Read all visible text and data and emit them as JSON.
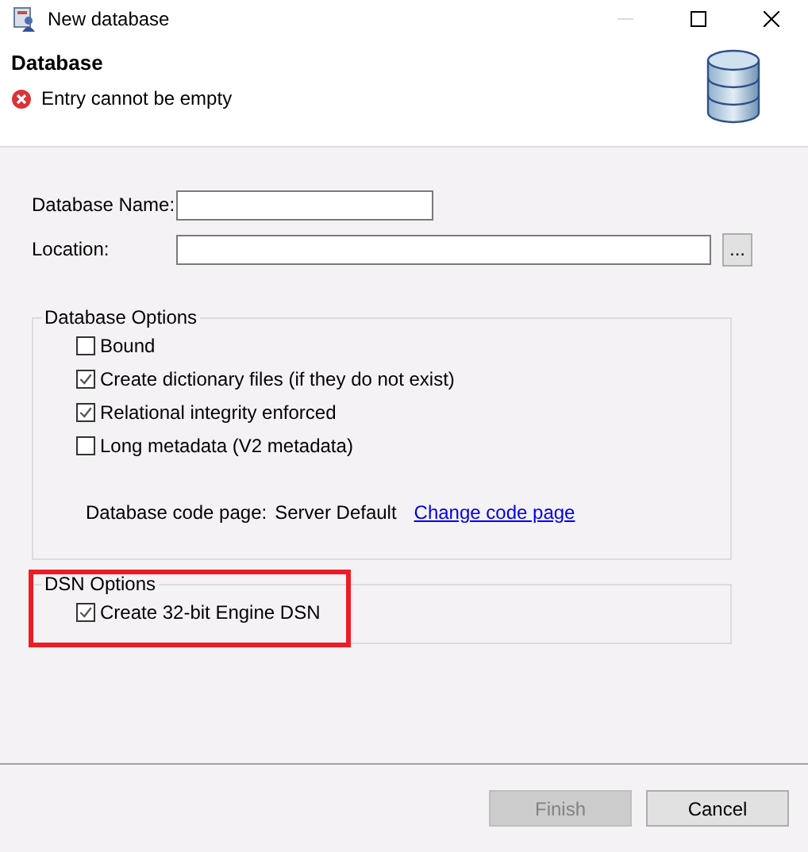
{
  "window": {
    "title": "New database",
    "controls": [
      {
        "kind": "minimize",
        "disabled": true
      },
      {
        "kind": "maximize",
        "disabled": false
      },
      {
        "kind": "close",
        "disabled": false
      }
    ]
  },
  "header": {
    "title": "Database",
    "error": "Entry cannot be empty"
  },
  "fields": [
    {
      "label": "Database Name:"
    },
    {
      "label": "Location:",
      "browse": "..."
    }
  ],
  "database_options": {
    "title": "Database Options",
    "checkboxes": [
      {
        "label": "Bound",
        "checked": false
      },
      {
        "label": "Create dictionary files (if they do not exist)",
        "checked": true
      },
      {
        "label": "Relational integrity enforced",
        "checked": true
      },
      {
        "label": "Long metadata (V2 metadata)",
        "checked": false
      }
    ],
    "code_page_label": "Database code page:",
    "code_page_value": "Server Default",
    "code_page_link": "Change code page"
  },
  "dsn_options": {
    "title": "DSN Options",
    "highlighted": true,
    "checkboxes": [
      {
        "label": "Create 32-bit Engine DSN",
        "checked": true
      }
    ]
  },
  "buttons": [
    {
      "label": "Finish",
      "disabled": true
    },
    {
      "label": "Cancel",
      "disabled": false
    }
  ]
}
